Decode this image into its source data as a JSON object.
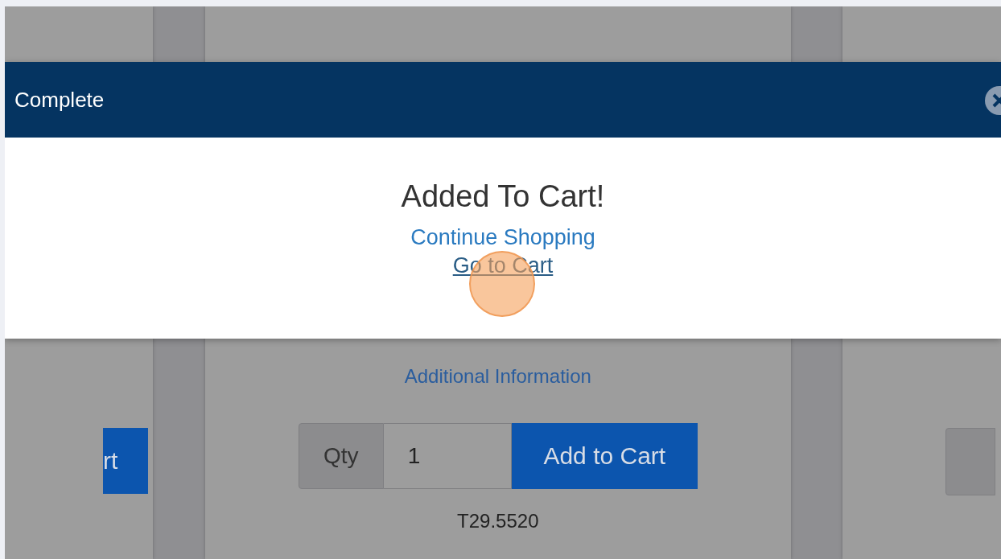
{
  "modal": {
    "title": "Complete",
    "message": "Added To Cart!",
    "links": [
      {
        "label": "Continue Shopping",
        "underlined": false
      },
      {
        "label": "Go to Cart",
        "underlined": true
      }
    ]
  },
  "products": [
    {
      "kind": "cut-left",
      "button": "rt"
    },
    {
      "kind": "full",
      "info_link": "Additional Information",
      "qty_label": "Qty",
      "qty_value": "1",
      "button": "Add to Cart",
      "sku": "T29.5520"
    },
    {
      "kind": "cut-right"
    }
  ],
  "click_marker": {
    "on": true
  }
}
